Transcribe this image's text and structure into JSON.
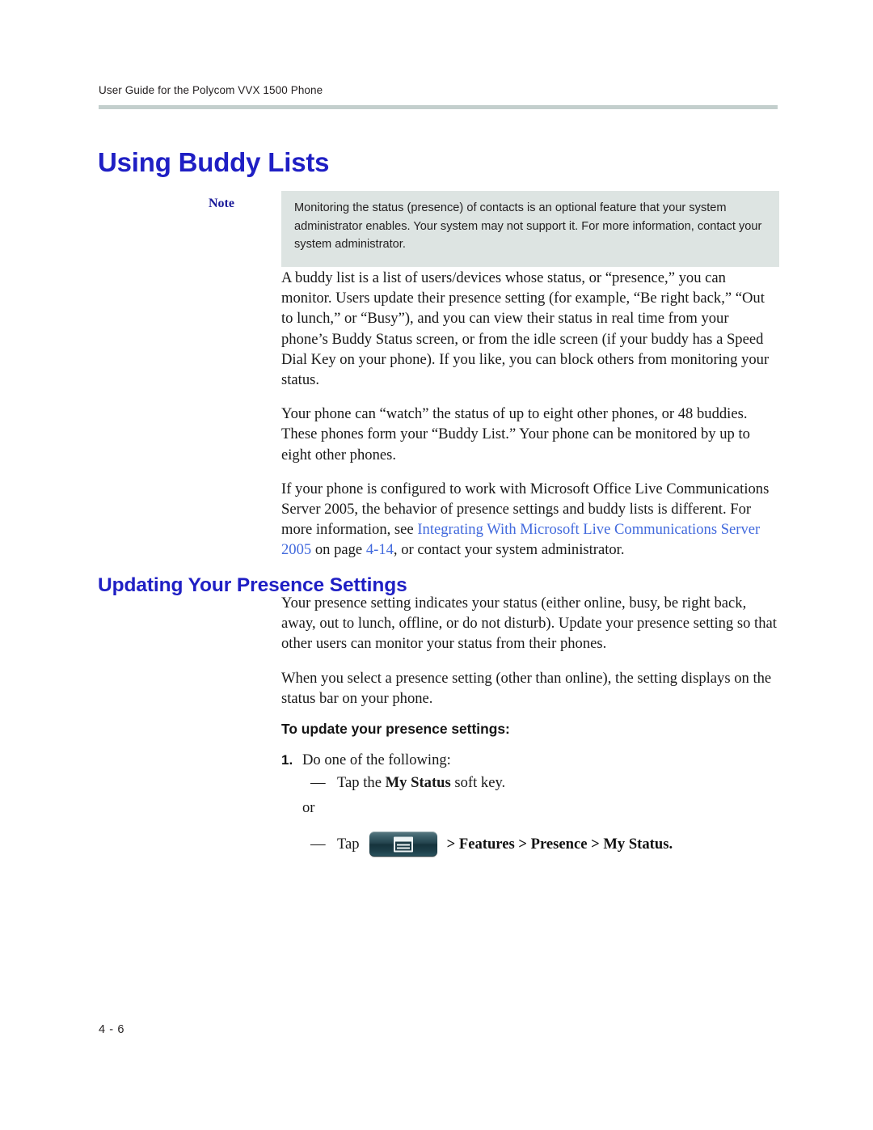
{
  "header": {
    "running_head": "User Guide for the Polycom VVX 1500 Phone"
  },
  "chapter_title": "Using Buddy Lists",
  "note": {
    "label": "Note",
    "text": "Monitoring the status (presence) of contacts is an optional feature that your system administrator enables. Your system may not support it. For more information, contact your system administrator."
  },
  "paragraphs": {
    "p1": "A buddy list is a list of users/devices whose status, or “presence,” you can monitor. Users update their presence setting (for example, “Be right back,” “Out to lunch,” or “Busy”), and you can view their status in real time from your phone’s Buddy Status screen, or from the idle screen (if your buddy has a Speed Dial Key on your phone). If you like, you can block others from monitoring your status.",
    "p2": "Your phone can “watch” the status of up to eight other phones, or 48 buddies. These phones form your “Buddy List.” Your phone can be monitored by up to eight other phones.",
    "p3_part1": "If your phone is configured to work with Microsoft Office Live Communications Server 2005, the behavior of presence settings and buddy lists is different. For more information, see ",
    "p3_link1": "Integrating With Microsoft Live Communications Server 2005",
    "p3_part2": " on page ",
    "p3_link2": "4-14",
    "p3_part3": ", or contact your system administrator."
  },
  "section": {
    "heading": "Updating Your Presence Settings",
    "p1": "Your presence setting indicates your status (either online, busy, be right back, away, out to lunch, offline, or do not disturb). Update your presence setting so that other users can monitor your status from their phones.",
    "p2": "When you select a presence setting (other than online), the setting displays on the status bar on your phone."
  },
  "procedure": {
    "title": "To update your presence settings:",
    "step1_num": "1.",
    "step1_text": "Do one of the following:",
    "bullet1_dash": "—",
    "bullet1_text_pre": "Tap the ",
    "bullet1_text_bold": "My Status",
    "bullet1_text_post": " soft key.",
    "or": "or",
    "bullet2_dash": "—",
    "bullet2_tap": "Tap",
    "bullet2_key_icon": "menu-key-icon",
    "bullet2_trail": "> Features > Presence > My Status."
  },
  "footer": {
    "folio": "4 - 6"
  },
  "colors": {
    "heading_blue": "#1f1fc4",
    "note_label_blue": "#1a1a99",
    "link_blue": "#4169dd",
    "note_bg": "#dde4e2",
    "rule": "#c3cfcd"
  }
}
